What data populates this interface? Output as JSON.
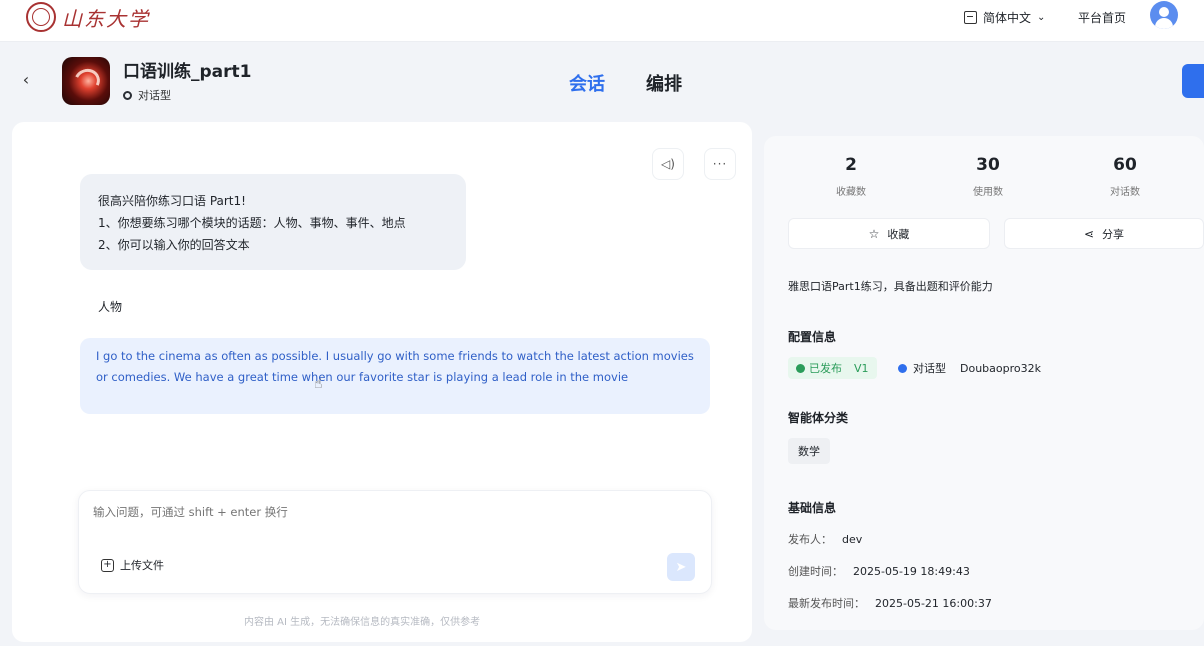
{
  "brand": {
    "logo_text": "山东大学"
  },
  "topbar": {
    "language": "简体中文",
    "home_link": "平台首页"
  },
  "header": {
    "back_icon": "chevron-left-icon",
    "agent_title": "口语训练_part1",
    "agent_type": "对话型",
    "tabs": [
      {
        "label": "会话",
        "active": true
      },
      {
        "label": "编排",
        "active": false
      }
    ]
  },
  "chat": {
    "toolbar": {
      "voice_icon": "speaker-icon",
      "more_icon": "ellipsis-icon",
      "more_label": "···"
    },
    "bot_message": {
      "lines": [
        "很高兴陪你练习口语 Part1!",
        "1、你想要练习哪个模块的话题：人物、事物、事件、地点",
        "2、你可以输入你的回答文本"
      ]
    },
    "user_messages": [
      "人物",
      "I go to the cinema as often as possible. I usually go with some friends to watch the latest action movies or comedies. We have a great time when our favorite star is playing a lead role in the movie"
    ],
    "composer": {
      "placeholder": "输入问题，可通过 shift + enter 换行",
      "upload_label": "上传文件",
      "send_icon": "send-icon"
    },
    "disclaimer": "内容由 AI 生成，无法确保信息的真实准确，仅供参考"
  },
  "info": {
    "stats": [
      {
        "value": "2",
        "label": "收藏数"
      },
      {
        "value": "30",
        "label": "使用数"
      },
      {
        "value": "60",
        "label": "对话数"
      }
    ],
    "actions": {
      "favorite": "收藏",
      "share": "分享"
    },
    "description": "雅思口语Part1练习，具备出题和评价能力",
    "config": {
      "title": "配置信息",
      "status": "已发布",
      "version": "V1",
      "type": "对话型",
      "model": "Doubaopro32k"
    },
    "category": {
      "title": "智能体分类",
      "tag": "数学"
    },
    "basic": {
      "title": "基础信息",
      "publisher_label": "发布人：",
      "publisher": "dev",
      "created_label": "创建时间：",
      "created": "2025-05-19 18:49:43",
      "updated_label": "最新发布时间：",
      "updated": "2025-05-21 16:00:37"
    }
  },
  "colors": {
    "accent": "#2f6fed",
    "brand": "#a83232",
    "success": "#2b9c5a"
  }
}
